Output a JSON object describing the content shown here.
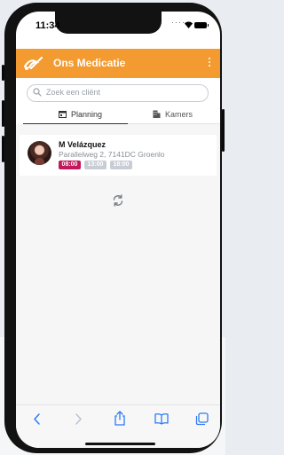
{
  "status_bar": {
    "time": "11:34"
  },
  "app": {
    "title": "Ons Medicatie",
    "accent": "#f39a30"
  },
  "search": {
    "placeholder": "Zoek een cliënt"
  },
  "tabs": [
    {
      "label": "Planning",
      "icon": "calendar-icon",
      "active": true
    },
    {
      "label": "Kamers",
      "icon": "building-icon",
      "active": false
    }
  ],
  "clients": [
    {
      "name": "M Velázquez",
      "address": "Parallelweg 2, 7141DC Groenlo",
      "times": [
        {
          "label": "08:00",
          "color": "#c2185b"
        },
        {
          "label": "13:00",
          "color": "#c9ced6"
        },
        {
          "label": "18:00",
          "color": "#c9ced6"
        }
      ]
    }
  ],
  "icons": {
    "sync": "sync-icon",
    "back": "chevron-left-icon",
    "forward": "chevron-right-icon",
    "share": "share-icon",
    "bookmarks": "book-icon",
    "tabs": "tabs-icon"
  }
}
